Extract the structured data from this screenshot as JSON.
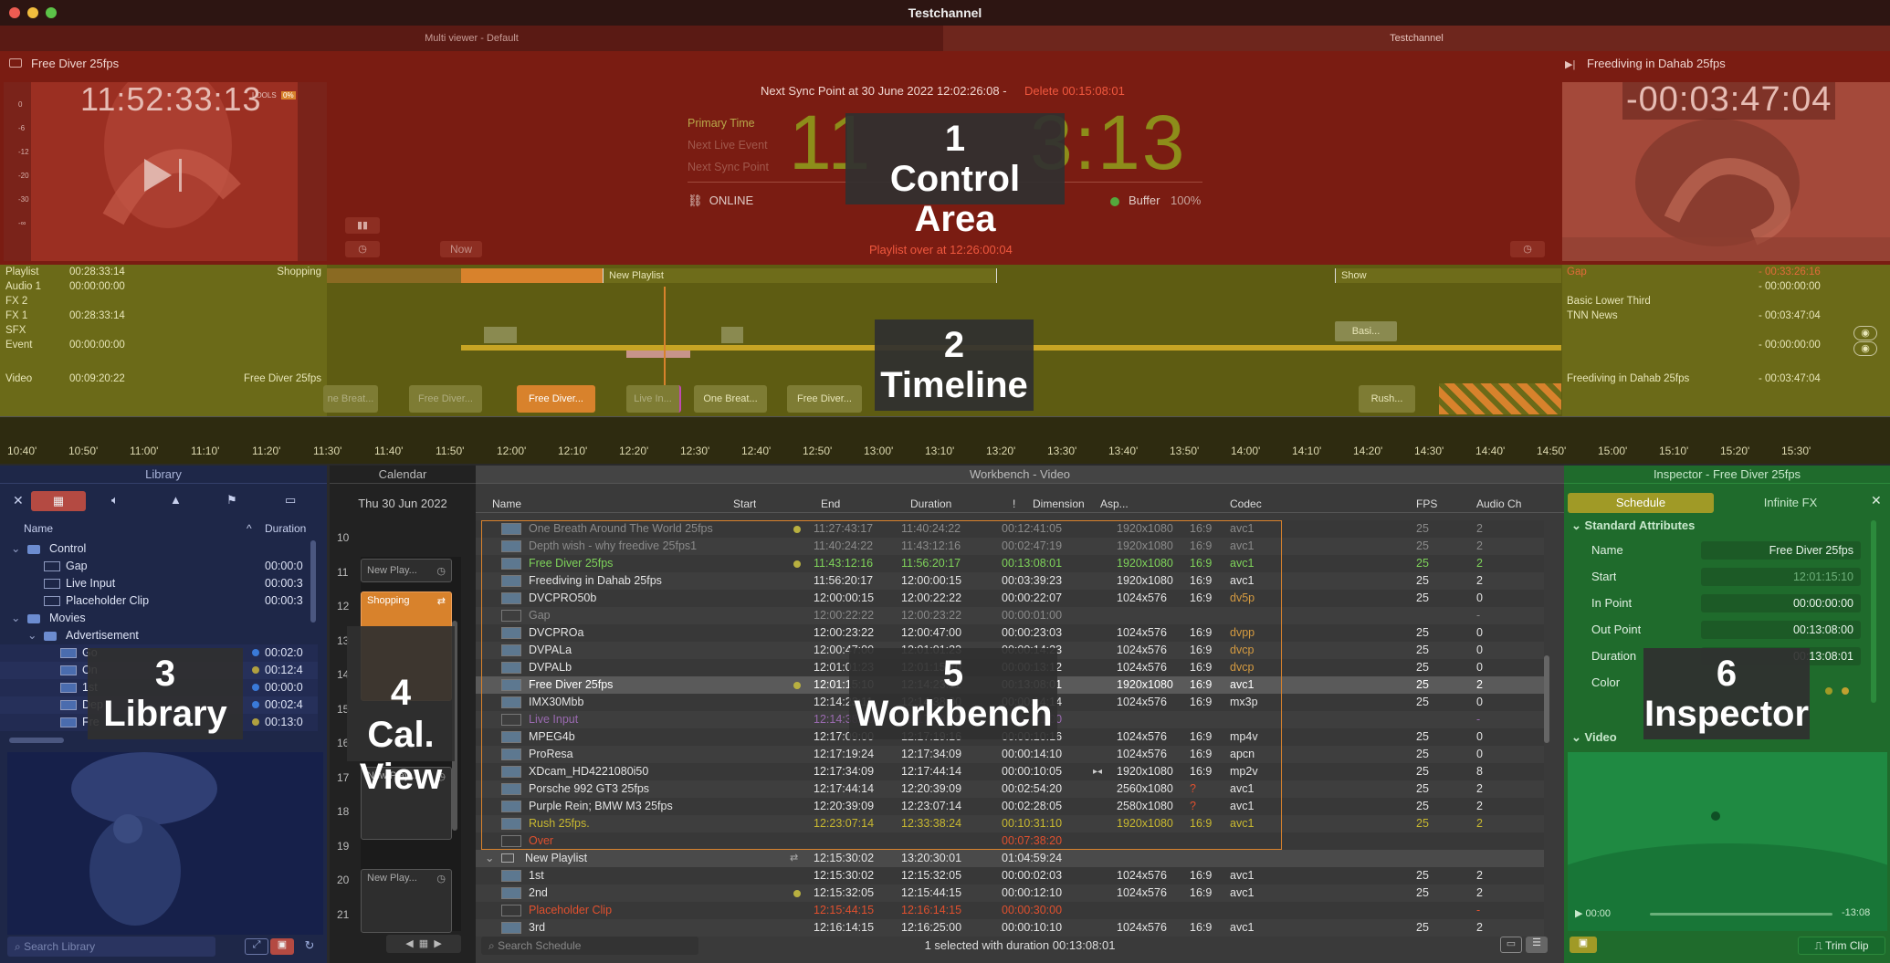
{
  "window": {
    "title": "Testchannel"
  },
  "tabs": [
    {
      "label": "Multi viewer - Default"
    },
    {
      "label": "Testchannel"
    }
  ],
  "control": {
    "left_monitor": {
      "title": "Free Diver   25fps",
      "timecode": "11:52:33:13",
      "badge_text": "LOOLS",
      "badge_value": "0%"
    },
    "meter_ticks": [
      "0",
      "-6",
      "-12",
      "-20",
      "-30",
      "-∞"
    ],
    "sync_point": {
      "text": "Next Sync Point at 30 June 2022 12:02:26:08 -",
      "delete": "Delete 00:15:08:01"
    },
    "labels": {
      "primary": "Primary Time",
      "next_live": "Next Live Event",
      "next_sync": "Next Sync Point"
    },
    "big_time_left": "11",
    "big_time_right": "3:13",
    "status": "ONLINE",
    "buffer_label": "Buffer",
    "buffer_value": "100%",
    "now_button": "Now",
    "playlist_over": "Playlist over at 12:26:00:04",
    "right_monitor": {
      "title": "Freediving in Dahab 25fps",
      "timecode": "-00:03:47:04"
    }
  },
  "timeline": {
    "rows": [
      {
        "label": "Playlist",
        "tc": "00:28:33:14",
        "name": "Shopping",
        "right_name": "Gap",
        "right_tc": "- 00:33:26:16"
      },
      {
        "label": "Audio 1",
        "tc": "00:00:00:00",
        "name": "",
        "right_name": "",
        "right_tc": "- 00:00:00:00"
      },
      {
        "label": "FX 2",
        "tc": "",
        "name": "",
        "right_name": "Basic Lower Third",
        "right_tc": ""
      },
      {
        "label": "FX 1",
        "tc": "00:28:33:14",
        "name": "",
        "right_name": "TNN News",
        "right_tc": "- 00:03:47:04"
      },
      {
        "label": "SFX",
        "tc": "",
        "name": "",
        "right_name": "",
        "right_tc": ""
      },
      {
        "label": "Event",
        "tc": "00:00:00:00",
        "name": "",
        "right_name": "",
        "right_tc": "- 00:00:00:00"
      },
      {
        "label": "Video",
        "tc": "00:09:20:22",
        "name": "Free Diver    25fps",
        "right_name": "Freediving in Dahab 25fps",
        "right_tc": "- 00:03:47:04"
      }
    ],
    "playlist_clips": [
      "New Playlist",
      "Show"
    ],
    "fx_clip": "Basi...",
    "video_clips": [
      "ne Breat...",
      "Free Diver...",
      "Free Diver...",
      "Live In...",
      "One Breat...",
      "Free Diver...",
      "Rush..."
    ],
    "ruler": [
      "10:40'",
      "10:50'",
      "11:00'",
      "11:10'",
      "11:20'",
      "11:30'",
      "11:40'",
      "11:50'",
      "12:00'",
      "12:10'",
      "12:20'",
      "12:30'",
      "12:40'",
      "12:50'",
      "13:00'",
      "13:10'",
      "13:20'",
      "13:30'",
      "13:40'",
      "13:50'",
      "14:00'",
      "14:10'",
      "14:20'",
      "14:30'",
      "14:40'",
      "14:50'",
      "15:00'",
      "15:10'",
      "15:20'",
      "15:30'"
    ]
  },
  "library": {
    "header": "Library",
    "col_name": "Name",
    "col_duration": "Duration",
    "items": [
      {
        "name": "Control",
        "dur": "",
        "level": 0,
        "kind": "folder"
      },
      {
        "name": "Gap",
        "dur": "00:00:0",
        "level": 1,
        "kind": "clip"
      },
      {
        "name": "Live Input",
        "dur": "00:00:3",
        "level": 1,
        "kind": "clip"
      },
      {
        "name": "Placeholder Clip",
        "dur": "00:00:3",
        "level": 1,
        "kind": "clip"
      },
      {
        "name": "Movies",
        "dur": "",
        "level": 0,
        "kind": "folder"
      },
      {
        "name": "Advertisement",
        "dur": "",
        "level": 1,
        "kind": "folder"
      },
      {
        "name": "Go",
        "dur": "00:02:0",
        "level": 2,
        "kind": "media"
      },
      {
        "name": "On",
        "dur": "00:12:4",
        "level": 2,
        "kind": "media"
      },
      {
        "name": "1st",
        "dur": "00:00:0",
        "level": 2,
        "kind": "media"
      },
      {
        "name": "Dep",
        "dur": "00:02:4",
        "level": 2,
        "kind": "media"
      },
      {
        "name": "Fre",
        "dur": "00:13:0",
        "level": 2,
        "kind": "media"
      }
    ],
    "search_placeholder": "Search Library"
  },
  "calendar": {
    "header": "Calendar",
    "date": "Thu 30 Jun 2022",
    "hours": [
      "10",
      "11",
      "12",
      "13",
      "14",
      "15",
      "16",
      "17",
      "18",
      "19",
      "20",
      "21"
    ],
    "events": [
      "New Play...",
      "Shopping",
      "New Play...",
      "New Play..."
    ]
  },
  "workbench": {
    "header": "Workbench - Video",
    "columns": [
      "Name",
      "Start",
      "End",
      "Duration",
      "!",
      "Dimension",
      "Asp...",
      "Codec",
      "FPS",
      "Audio Ch"
    ],
    "rows": [
      {
        "name": "One Breath Around The World 25fps",
        "start": "11:27:43:17",
        "end": "11:40:24:22",
        "dur": "00:12:41:05",
        "dim": "1920x1080",
        "asp": "16:9",
        "codec": "avc1",
        "fps": "25",
        "audio": "2",
        "style": "dim",
        "dot": true
      },
      {
        "name": "Depth wish - why freedive 25fps1",
        "start": "11:40:24:22",
        "end": "11:43:12:16",
        "dur": "00:02:47:19",
        "dim": "1920x1080",
        "asp": "16:9",
        "codec": "avc1",
        "fps": "25",
        "audio": "2",
        "style": "dim"
      },
      {
        "name": "Free Diver   25fps",
        "start": "11:43:12:16",
        "end": "11:56:20:17",
        "dur": "00:13:08:01",
        "dim": "1920x1080",
        "asp": "16:9",
        "codec": "avc1",
        "fps": "25",
        "audio": "2",
        "style": "green",
        "dot": true
      },
      {
        "name": "Freediving in Dahab 25fps",
        "start": "11:56:20:17",
        "end": "12:00:00:15",
        "dur": "00:03:39:23",
        "dim": "1920x1080",
        "asp": "16:9",
        "codec": "avc1",
        "fps": "25",
        "audio": "2",
        "style": "normal"
      },
      {
        "name": "DVCPRO50b",
        "start": "12:00:00:15",
        "end": "12:00:22:22",
        "dur": "00:00:22:07",
        "dim": "1024x576",
        "asp": "16:9",
        "codec": "dv5p",
        "fps": "25",
        "audio": "0",
        "style": "normal"
      },
      {
        "name": "Gap",
        "start": "12:00:22:22",
        "end": "12:00:23:22",
        "dur": "00:00:01:00",
        "dim": "",
        "asp": "",
        "codec": "",
        "fps": "",
        "audio": "-",
        "style": "dim"
      },
      {
        "name": "DVCPROa",
        "start": "12:00:23:22",
        "end": "12:00:47:00",
        "dur": "00:00:23:03",
        "dim": "1024x576",
        "asp": "16:9",
        "codec": "dvpp",
        "fps": "25",
        "audio": "0",
        "style": "normal"
      },
      {
        "name": "DVPALa",
        "start": "12:00:47:00",
        "end": "12:01:01:23",
        "dur": "00:00:14:23",
        "dim": "1024x576",
        "asp": "16:9",
        "codec": "dvcp",
        "fps": "25",
        "audio": "0",
        "style": "normal"
      },
      {
        "name": "DVPALb",
        "start": "12:01:01:23",
        "end": "12:01:15:10",
        "dur": "00:00:13:12",
        "dim": "1024x576",
        "asp": "16:9",
        "codec": "dvcp",
        "fps": "25",
        "audio": "0",
        "style": "normal"
      },
      {
        "name": "Free Diver   25fps",
        "start": "12:01:15:10",
        "end": "12:14:23:11",
        "dur": "00:13:08:01",
        "dim": "1920x1080",
        "asp": "16:9",
        "codec": "avc1",
        "fps": "25",
        "audio": "2",
        "style": "selected",
        "dot": true
      },
      {
        "name": "IMX30Mbb",
        "start": "12:14:23:11",
        "end": "12:14:38:00",
        "dur": "00:00:14:14",
        "dim": "1024x576",
        "asp": "16:9",
        "codec": "mx3p",
        "fps": "25",
        "audio": "0",
        "style": "normal"
      },
      {
        "name": "Live Input",
        "start": "12:14:38:00",
        "end": "12:17:09:00",
        "dur": "00:02:31:00",
        "dim": "",
        "asp": "",
        "codec": "",
        "fps": "",
        "audio": "-",
        "style": "purple"
      },
      {
        "name": "MPEG4b",
        "start": "12:17:09:00",
        "end": "12:17:19:16",
        "dur": "00:00:10:16",
        "dim": "1024x576",
        "asp": "16:9",
        "codec": "mp4v",
        "fps": "25",
        "audio": "0",
        "style": "normal"
      },
      {
        "name": "ProResa",
        "start": "12:17:19:24",
        "end": "12:17:34:09",
        "dur": "00:00:14:10",
        "dim": "1024x576",
        "asp": "16:9",
        "codec": "apcn",
        "fps": "25",
        "audio": "0",
        "style": "normal"
      },
      {
        "name": "XDcam_HD4221080i50",
        "start": "12:17:34:09",
        "end": "12:17:44:14",
        "dur": "00:00:10:05",
        "dim": "1920x1080",
        "asp": "16:9",
        "codec": "mp2v",
        "fps": "25",
        "audio": "8",
        "style": "normal",
        "mark": "▸◂"
      },
      {
        "name": "Porsche 992 GT3 25fps",
        "start": "12:17:44:14",
        "end": "12:20:39:09",
        "dur": "00:02:54:20",
        "dim": "2560x1080",
        "asp": "?",
        "codec": "avc1",
        "fps": "25",
        "audio": "2",
        "style": "normal"
      },
      {
        "name": "Purple Rein; BMW M3   25fps",
        "start": "12:20:39:09",
        "end": "12:23:07:14",
        "dur": "00:02:28:05",
        "dim": "2580x1080",
        "asp": "?",
        "codec": "avc1",
        "fps": "25",
        "audio": "2",
        "style": "normal"
      },
      {
        "name": "Rush  25fps.",
        "start": "12:23:07:14",
        "end": "12:33:38:24",
        "dur": "00:10:31:10",
        "dim": "1920x1080",
        "asp": "16:9",
        "codec": "avc1",
        "fps": "25",
        "audio": "2",
        "style": "yellow"
      },
      {
        "name": "Over",
        "start": "",
        "end": "",
        "dur": "00:07:38:20",
        "dim": "",
        "asp": "",
        "codec": "",
        "fps": "",
        "audio": "",
        "style": "red"
      },
      {
        "name": "New Playlist",
        "start": "12:15:30:02",
        "end": "13:20:30:01",
        "dur": "01:04:59:24",
        "dim": "",
        "asp": "",
        "codec": "",
        "fps": "",
        "audio": "",
        "style": "group"
      },
      {
        "name": "1st",
        "start": "12:15:30:02",
        "end": "12:15:32:05",
        "dur": "00:00:02:03",
        "dim": "1024x576",
        "asp": "16:9",
        "codec": "avc1",
        "fps": "25",
        "audio": "2",
        "style": "normal"
      },
      {
        "name": "2nd",
        "start": "12:15:32:05",
        "end": "12:15:44:15",
        "dur": "00:00:12:10",
        "dim": "1024x576",
        "asp": "16:9",
        "codec": "avc1",
        "fps": "25",
        "audio": "2",
        "style": "normal",
        "dot": true
      },
      {
        "name": "Placeholder Clip",
        "start": "12:15:44:15",
        "end": "12:16:14:15",
        "dur": "00:00:30:00",
        "dim": "",
        "asp": "",
        "codec": "",
        "fps": "",
        "audio": "-",
        "style": "red"
      },
      {
        "name": "3rd",
        "start": "12:16:14:15",
        "end": "12:16:25:00",
        "dur": "00:00:10:10",
        "dim": "1024x576",
        "asp": "16:9",
        "codec": "avc1",
        "fps": "25",
        "audio": "2",
        "style": "normal"
      }
    ],
    "search_placeholder": "Search Schedule",
    "status": "1 selected with duration 00:13:08:01"
  },
  "inspector": {
    "header": "Inspector - Free Diver   25fps",
    "tabs": [
      "Schedule",
      "Infinite FX"
    ],
    "section_standard": "Standard Attributes",
    "fields": [
      {
        "label": "Name",
        "value": "Free Diver   25fps"
      },
      {
        "label": "Start",
        "value": "12:01:15:10"
      },
      {
        "label": "In Point",
        "value": "00:00:00:00"
      },
      {
        "label": "Out Point",
        "value": "00:13:08:00"
      },
      {
        "label": "Duration",
        "value": "00:13:08:01"
      },
      {
        "label": "Color",
        "value": ""
      }
    ],
    "section_video": "Video",
    "player_start": "00:00",
    "player_end": "-13:08",
    "trim_button": "Trim Clip"
  },
  "overlays": [
    {
      "num": "1",
      "label": "Control Area"
    },
    {
      "num": "2",
      "label": "Timeline"
    },
    {
      "num": "3",
      "label": "Library"
    },
    {
      "num": "4",
      "label": "Cal.\nView"
    },
    {
      "num": "5",
      "label": "Workbench"
    },
    {
      "num": "6",
      "label": "Inspector"
    }
  ],
  "colors": {
    "control_bg": "#7a1c12",
    "timeline_bg": "#6b6a18",
    "library_bg": "#1e2748",
    "inspector_bg": "#1f6b2c",
    "accent_orange": "#d8822c",
    "big_time": "#8d8d1a"
  }
}
